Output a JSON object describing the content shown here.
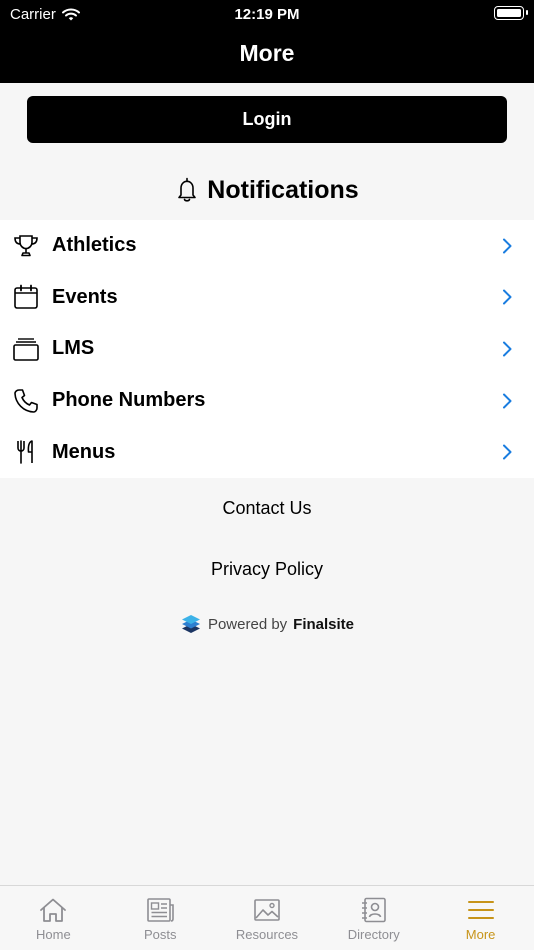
{
  "status_bar": {
    "carrier": "Carrier",
    "time": "12:19 PM"
  },
  "header": {
    "title": "More"
  },
  "login_button": {
    "label": "Login"
  },
  "notifications": {
    "label": "Notifications",
    "icon": "bell-icon"
  },
  "menu": {
    "items": [
      {
        "label": "Athletics",
        "icon": "trophy-icon"
      },
      {
        "label": "Events",
        "icon": "calendar-icon"
      },
      {
        "label": "LMS",
        "icon": "stack-icon"
      },
      {
        "label": "Phone Numbers",
        "icon": "phone-icon"
      },
      {
        "label": "Menus",
        "icon": "utensils-icon"
      }
    ]
  },
  "links": {
    "contact": "Contact Us",
    "privacy": "Privacy Policy"
  },
  "powered_by": {
    "prefix": "Powered by",
    "brand": "Finalsite"
  },
  "tabbar": {
    "tabs": [
      {
        "label": "Home",
        "icon": "home-icon"
      },
      {
        "label": "Posts",
        "icon": "newspaper-icon"
      },
      {
        "label": "Resources",
        "icon": "image-icon"
      },
      {
        "label": "Directory",
        "icon": "contacts-icon"
      },
      {
        "label": "More",
        "icon": "menu-icon",
        "active": true
      }
    ]
  },
  "colors": {
    "accent": "#c79419",
    "chevron": "#1a7de0",
    "header_bg": "#000000"
  }
}
